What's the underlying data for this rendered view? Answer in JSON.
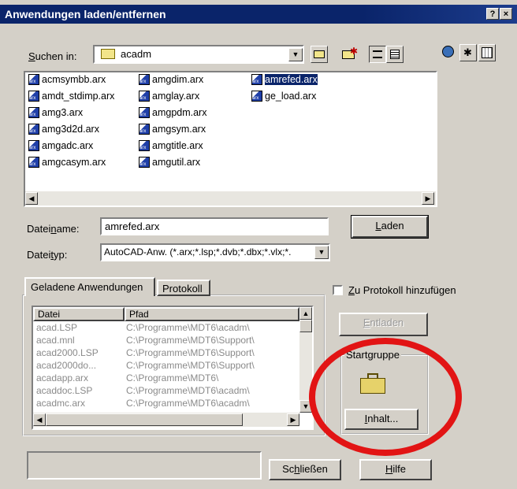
{
  "window": {
    "title": "Anwendungen laden/entfernen",
    "help_btn": "?",
    "close_btn": "×"
  },
  "lookin": {
    "label_pre": "",
    "label_u": "S",
    "label_post": "uchen in:",
    "value": "acadm"
  },
  "files": {
    "col1": [
      "acmsymbb.arx",
      "amdt_stdimp.arx",
      "amg3.arx",
      "amg3d2d.arx",
      "amgadc.arx",
      "amgcasym.arx"
    ],
    "col2": [
      "amgdim.arx",
      "amglay.arx",
      "amgpdm.arx",
      "amgsym.arx",
      "amgtitle.arx",
      "amgutil.arx"
    ],
    "col3": [
      "amrefed.arx",
      "ge_load.arx"
    ],
    "selected": "amrefed.arx"
  },
  "filename": {
    "label_pre": "Datei",
    "label_u": "n",
    "label_post": "ame:",
    "value": "amrefed.arx"
  },
  "filetype": {
    "label_pre": "Datei",
    "label_u": "t",
    "label_post": "yp:",
    "value": "AutoCAD-Anw. (*.arx;*.lsp;*.dvb;*.dbx;*.vlx;*."
  },
  "buttons": {
    "load_u": "L",
    "load_rest": "aden",
    "unload_u": "E",
    "unload_rest": "ntladen",
    "contents_u": "I",
    "contents_rest": "nhalt...",
    "close_pre": "Sc",
    "close_u": "h",
    "close_post": "ließen",
    "help_u": "H",
    "help_rest": "ilfe"
  },
  "tabs": {
    "loaded": "Geladene Anwendungen",
    "log": "Protokoll"
  },
  "log_checkbox": {
    "u": "Z",
    "rest": "u Protokoll hinzufügen",
    "checked": false
  },
  "table": {
    "headers": [
      "Datei",
      "Pfad"
    ],
    "rows": [
      [
        "acad.LSP",
        "C:\\Programme\\MDT6\\acadm\\"
      ],
      [
        "acad.mnl",
        "C:\\Programme\\MDT6\\Support\\"
      ],
      [
        "acad2000.LSP",
        "C:\\Programme\\MDT6\\Support\\"
      ],
      [
        "acad2000do...",
        "C:\\Programme\\MDT6\\Support\\"
      ],
      [
        "acadapp.arx",
        "C:\\Programme\\MDT6\\"
      ],
      [
        "acaddoc.LSP",
        "C:\\Programme\\MDT6\\acadm\\"
      ],
      [
        "acadmc.arx",
        "C:\\Programme\\MDT6\\acadm\\"
      ]
    ]
  },
  "startgroup": {
    "label": "Startgruppe"
  },
  "colors": {
    "title_bar": "#0a246a",
    "face": "#d4d0c8",
    "highlight_circle": "#e21414",
    "disabled_text": "#8a8a8a"
  }
}
